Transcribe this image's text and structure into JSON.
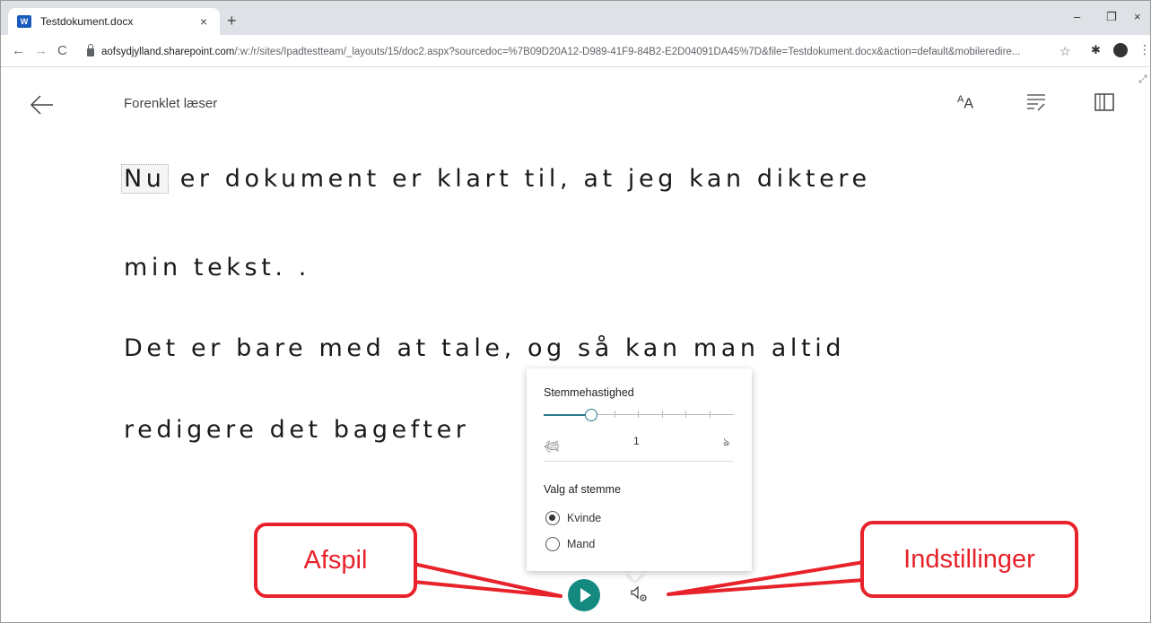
{
  "browser": {
    "tab_title": "Testdokument.docx",
    "tab_favicon": "W",
    "url_host": "aofsydjylland.sharepoint.com",
    "url_path": "/:w:/r/sites/Ipadtestteam/_layouts/15/doc2.aspx?sourcedoc=%7B09D20A12-D989-41F9-84B2-E2D04091DA45%7D&file=Testdokument.docx&action=default&mobileredire..."
  },
  "reader": {
    "title": "Forenklet læser",
    "highlight_word": "Nu",
    "lines": [
      " er dokument er klart til, at jeg kan diktere",
      "min tekst. .",
      "Det er bare med at tale, og så kan man altid",
      "redigere det bagefter"
    ]
  },
  "voice_settings": {
    "speed_label": "Stemmehastighed",
    "speed_value": "1",
    "speed_fraction": 0.2,
    "voice_label": "Valg af stemme",
    "options": [
      {
        "label": "Kvinde",
        "selected": true
      },
      {
        "label": "Mand",
        "selected": false
      }
    ]
  },
  "annotations": {
    "play_label": "Afspil",
    "settings_label": "Indstillinger",
    "color": "#e8222a"
  },
  "colors": {
    "accent": "#14897f",
    "slider": "#2b7a8c"
  },
  "icons": [
    "back-arrow-icon",
    "text-size-icon",
    "grammar-options-icon",
    "book-icon",
    "play-icon",
    "voice-settings-icon",
    "turtle-icon",
    "rabbit-icon"
  ]
}
